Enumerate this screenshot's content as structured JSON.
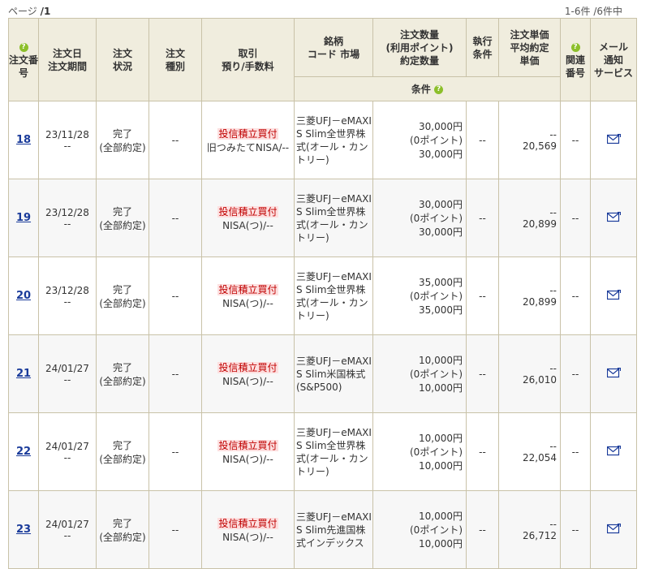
{
  "pagination": {
    "page_label": "ページ",
    "page_value": "/1",
    "count_text": "1-6件 /6件中"
  },
  "headers": {
    "order_no": "注文番号",
    "order_date": "注文日\n注文期間",
    "status": "注文\n状況",
    "order_type": "注文\n種別",
    "trade": "取引\n預り/手数料",
    "fund": "銘柄\nコード 市場",
    "qty": "注文数量\n(利用ポイント)\n約定数量",
    "exec_cond": "執行\n条件",
    "price": "注文単価\n平均約定\n単価",
    "related": "関連\n番号",
    "mail": "メール\n通知\nサービス",
    "condition": "条件",
    "help_icon": "?"
  },
  "orders": [
    {
      "id": "18",
      "date": "23/11/28",
      "period": "--",
      "status": "完了\n(全部約定)",
      "order_type": "--",
      "trade_type": "投信積立買付",
      "account": "旧つみたてNISA/--",
      "fund": "三菱UFJ－eMAXIS Slim全世界株式(オール・カントリー)",
      "qty": "30,000円",
      "points": "(0ポイント)",
      "exec_qty": "30,000円",
      "exec_cond": "--",
      "order_price": "--",
      "avg_price": "20,569",
      "related": "--"
    },
    {
      "id": "19",
      "date": "23/12/28",
      "period": "--",
      "status": "完了\n(全部約定)",
      "order_type": "--",
      "trade_type": "投信積立買付",
      "account": "NISA(つ)/--",
      "fund": "三菱UFJ－eMAXIS Slim全世界株式(オール・カントリー)",
      "qty": "30,000円",
      "points": "(0ポイント)",
      "exec_qty": "30,000円",
      "exec_cond": "--",
      "order_price": "--",
      "avg_price": "20,899",
      "related": "--"
    },
    {
      "id": "20",
      "date": "23/12/28",
      "period": "--",
      "status": "完了\n(全部約定)",
      "order_type": "--",
      "trade_type": "投信積立買付",
      "account": "NISA(つ)/--",
      "fund": "三菱UFJ－eMAXIS Slim全世界株式(オール・カントリー)",
      "qty": "35,000円",
      "points": "(0ポイント)",
      "exec_qty": "35,000円",
      "exec_cond": "--",
      "order_price": "--",
      "avg_price": "20,899",
      "related": "--"
    },
    {
      "id": "21",
      "date": "24/01/27",
      "period": "--",
      "status": "完了\n(全部約定)",
      "order_type": "--",
      "trade_type": "投信積立買付",
      "account": "NISA(つ)/--",
      "fund": "三菱UFJ－eMAXIS Slim米国株式(S&P500)",
      "qty": "10,000円",
      "points": "(0ポイント)",
      "exec_qty": "10,000円",
      "exec_cond": "--",
      "order_price": "--",
      "avg_price": "26,010",
      "related": "--"
    },
    {
      "id": "22",
      "date": "24/01/27",
      "period": "--",
      "status": "完了\n(全部約定)",
      "order_type": "--",
      "trade_type": "投信積立買付",
      "account": "NISA(つ)/--",
      "fund": "三菱UFJ－eMAXIS Slim全世界株式(オール・カントリー)",
      "qty": "10,000円",
      "points": "(0ポイント)",
      "exec_qty": "10,000円",
      "exec_cond": "--",
      "order_price": "--",
      "avg_price": "22,054",
      "related": "--"
    },
    {
      "id": "23",
      "date": "24/01/27",
      "period": "--",
      "status": "完了\n(全部約定)",
      "order_type": "--",
      "trade_type": "投信積立買付",
      "account": "NISA(つ)/--",
      "fund": "三菱UFJ－eMAXIS Slim先進国株式インデックス",
      "qty": "10,000円",
      "points": "(0ポイント)",
      "exec_qty": "10,000円",
      "exec_cond": "--",
      "order_price": "--",
      "avg_price": "26,712",
      "related": "--"
    }
  ],
  "colors": {
    "header_bg": "#f0edde",
    "border": "#c9c2a8",
    "link": "#1a3b9a",
    "trade_type_bg": "#fde0e0",
    "trade_type_fg": "#c00000",
    "help_icon": "#8cbf2a"
  }
}
